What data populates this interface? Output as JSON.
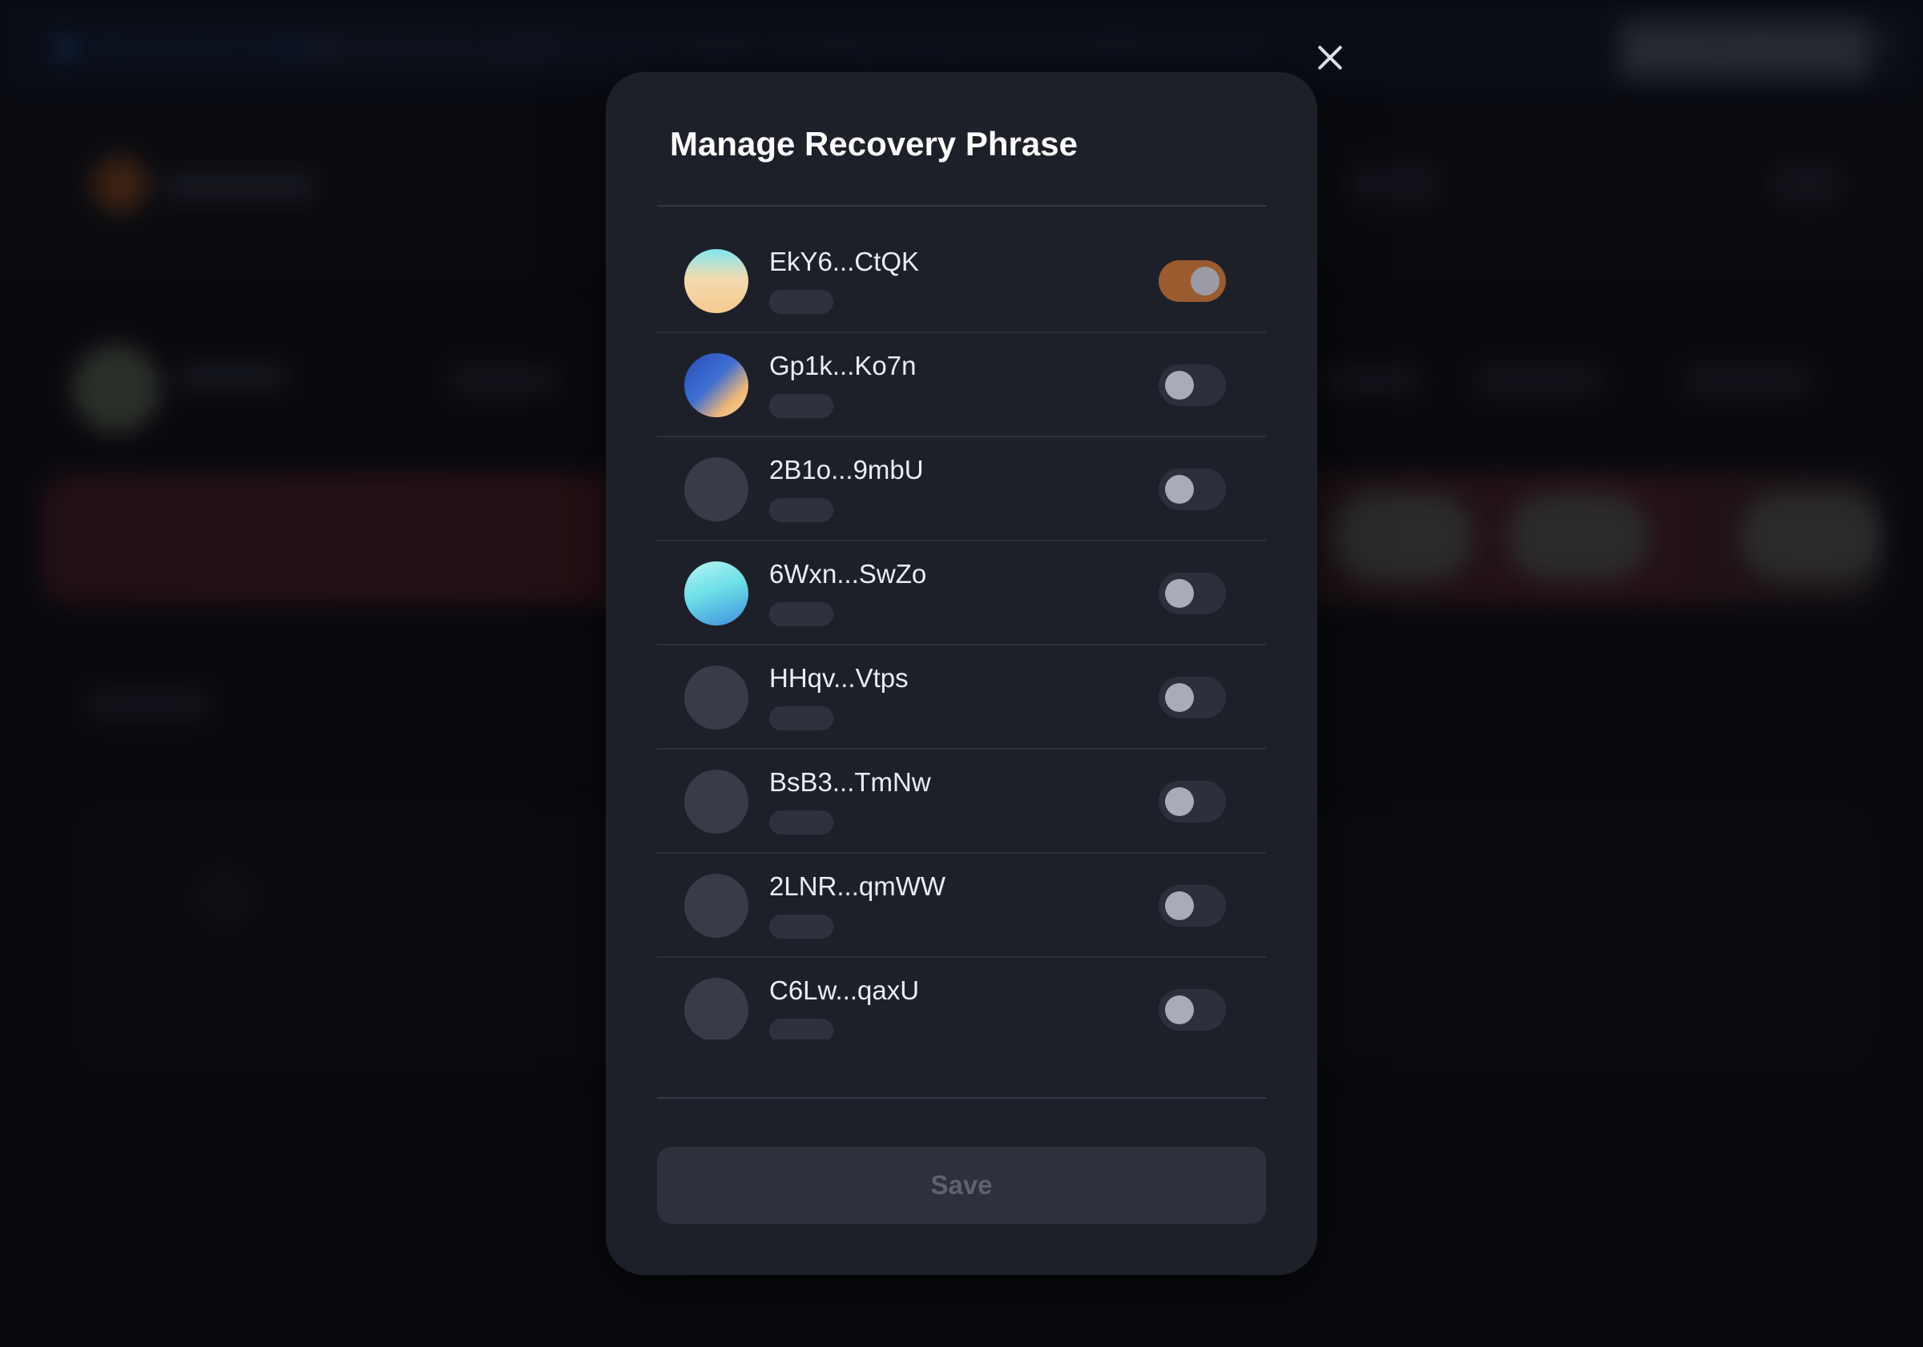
{
  "banner": {
    "title": "Now online in Beta!",
    "text": "Get real-time updates on your wallet, including transactions and NFTs received",
    "enable_label": "Enable notifications",
    "close_glyph": "✕"
  },
  "modal": {
    "title": "Manage Recovery Phrase",
    "save_label": "Save",
    "close_glyph": "×"
  },
  "accounts": [
    {
      "name": "EkY6...CtQK",
      "enabled": true,
      "avatar": "linear-gradient(180deg, #7fe6f0 0%, #f3dcb0 45%, #f7c98e 100%)"
    },
    {
      "name": "Gp1k...Ko7n",
      "enabled": false,
      "avatar": "linear-gradient(135deg, #2a4bb8 0%, #3d6fd0 45%, #f0b776 75%, #f7d3a2 100%)"
    },
    {
      "name": "2B1o...9mbU",
      "enabled": false,
      "avatar": null
    },
    {
      "name": "6Wxn...SwZo",
      "enabled": false,
      "avatar": "linear-gradient(160deg, #b7f4f3 0%, #6de0e8 45%, #3f8fde 100%)"
    },
    {
      "name": "HHqv...Vtps",
      "enabled": false,
      "avatar": null
    },
    {
      "name": "BsB3...TmNw",
      "enabled": false,
      "avatar": null
    },
    {
      "name": "2LNR...qmWW",
      "enabled": false,
      "avatar": null
    },
    {
      "name": "C6Lw...qaxU",
      "enabled": false,
      "avatar": null
    }
  ],
  "colors": {
    "toggle_on": "#9a5b2e",
    "toggle_off": "#2d303c",
    "modal_bg": "#1e2029"
  }
}
